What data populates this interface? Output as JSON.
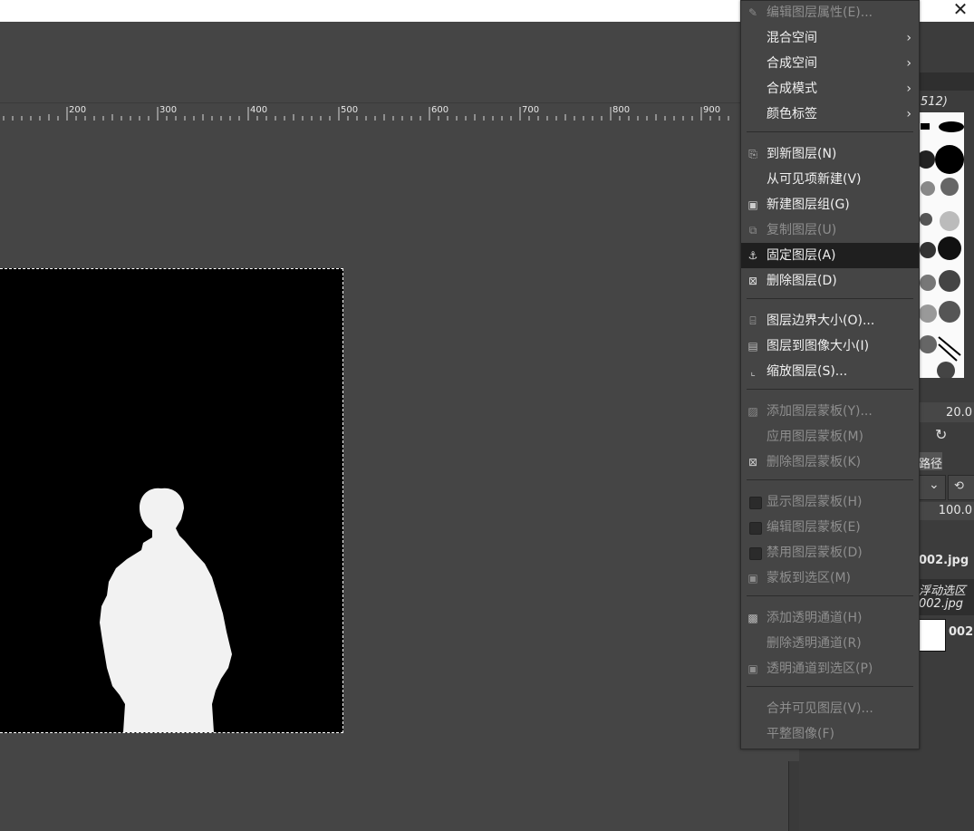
{
  "window": {
    "close_glyph": "✕"
  },
  "ruler": {
    "labels": [
      "200",
      "300",
      "400",
      "500",
      "600",
      "700",
      "800",
      "900"
    ]
  },
  "right_panel": {
    "brush_size_text": "512)",
    "size_value": "20.0",
    "paths_tab": "路径",
    "opacity_value": "100.0",
    "image_name_1": "002.jpg",
    "floating_sel_label": "浮动选区",
    "image_name_2": "002.jpg",
    "layer_name": "002"
  },
  "context_menu": {
    "items": [
      {
        "label": "编辑图层属性(E)...",
        "enabled": false,
        "icon": "edit-icon"
      },
      {
        "label": "混合空间",
        "enabled": true,
        "submenu": true
      },
      {
        "label": "合成空间",
        "enabled": true,
        "submenu": true
      },
      {
        "label": "合成模式",
        "enabled": true,
        "submenu": true
      },
      {
        "label": "颜色标签",
        "enabled": true,
        "submenu": true
      },
      {
        "label": "到新图层(N)",
        "enabled": true,
        "icon": "new-layer-icon"
      },
      {
        "label": "从可见项新建(V)",
        "enabled": true
      },
      {
        "label": "新建图层组(G)",
        "enabled": true,
        "icon": "layer-group-icon"
      },
      {
        "label": "复制图层(U)",
        "enabled": false,
        "icon": "duplicate-icon"
      },
      {
        "label": "固定图层(A)",
        "enabled": true,
        "icon": "anchor-icon",
        "highlighted": true
      },
      {
        "label": "删除图层(D)",
        "enabled": true,
        "icon": "delete-icon"
      },
      {
        "label": "图层边界大小(O)...",
        "enabled": true,
        "icon": "boundary-icon"
      },
      {
        "label": "图层到图像大小(I)",
        "enabled": true,
        "icon": "layer-to-image-icon"
      },
      {
        "label": "缩放图层(S)...",
        "enabled": true,
        "icon": "scale-icon"
      },
      {
        "label": "添加图层蒙板(Y)...",
        "enabled": false,
        "icon": "add-mask-icon"
      },
      {
        "label": "应用图层蒙板(M)",
        "enabled": false
      },
      {
        "label": "删除图层蒙板(K)",
        "enabled": false,
        "icon": "delete-mask-icon"
      },
      {
        "label": "显示图层蒙板(H)",
        "enabled": false,
        "checkbox": true
      },
      {
        "label": "编辑图层蒙板(E)",
        "enabled": false,
        "checkbox": true
      },
      {
        "label": "禁用图层蒙板(D)",
        "enabled": false,
        "checkbox": true
      },
      {
        "label": "蒙板到选区(M)",
        "enabled": false,
        "icon": "mask-to-selection-icon"
      },
      {
        "label": "添加透明通道(H)",
        "enabled": false,
        "icon": "alpha-icon"
      },
      {
        "label": "删除透明通道(R)",
        "enabled": false
      },
      {
        "label": "透明通道到选区(P)",
        "enabled": false,
        "icon": "alpha-to-selection-icon"
      },
      {
        "label": "合并可见图层(V)...",
        "enabled": false
      },
      {
        "label": "平整图像(F)",
        "enabled": false
      }
    ]
  }
}
